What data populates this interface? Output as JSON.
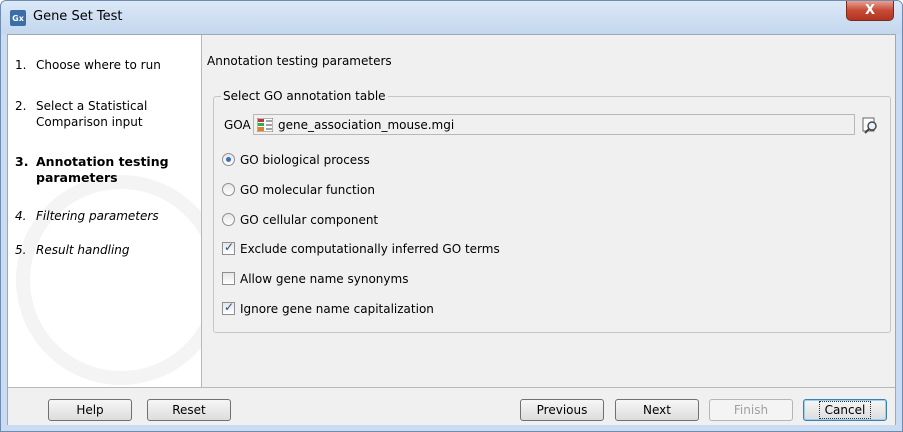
{
  "window": {
    "app_icon": "Gx",
    "title": "Gene Set Test",
    "close_glyph": "X"
  },
  "steps": [
    {
      "num": "1.",
      "label": "Choose where to run",
      "state": "done"
    },
    {
      "num": "2.",
      "label": "Select a Statistical Comparison input",
      "state": "done"
    },
    {
      "num": "3.",
      "label": "Annotation testing parameters",
      "state": "active"
    },
    {
      "num": "4.",
      "label": "Filtering parameters",
      "state": "future"
    },
    {
      "num": "5.",
      "label": "Result handling",
      "state": "future"
    }
  ],
  "main": {
    "section_title": "Annotation testing parameters",
    "group_title": "Select GO annotation table",
    "goa_label": "GOA",
    "goa_value": "gene_association_mouse.mgi",
    "options": [
      {
        "kind": "radio",
        "label": "GO biological process",
        "checked": true
      },
      {
        "kind": "radio",
        "label": "GO molecular function",
        "checked": false
      },
      {
        "kind": "radio",
        "label": "GO cellular component",
        "checked": false
      },
      {
        "kind": "checkbox",
        "label": "Exclude computationally inferred GO terms",
        "checked": true
      },
      {
        "kind": "checkbox",
        "label": "Allow gene name synonyms",
        "checked": false
      },
      {
        "kind": "checkbox",
        "label": "Ignore gene name capitalization",
        "checked": true
      }
    ]
  },
  "buttons": {
    "help": "Help",
    "reset": "Reset",
    "previous": "Previous",
    "next": "Next",
    "finish": "Finish",
    "cancel": "Cancel"
  },
  "icons": {
    "app": "gx-app-icon",
    "table": "table-icon",
    "browse": "browse-icon",
    "close": "close-icon"
  }
}
